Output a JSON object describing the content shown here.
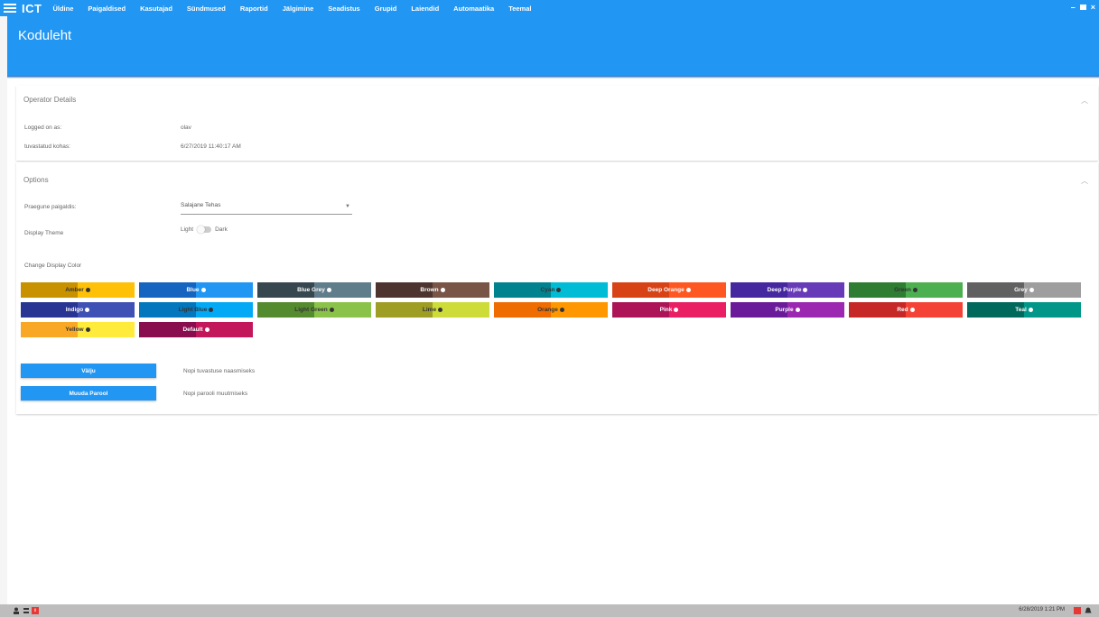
{
  "nav": {
    "brand": "ICT",
    "items": [
      "Üldine",
      "Paigaldised",
      "Kasutajad",
      "Sündmused",
      "Raportid",
      "Jälgimine",
      "Seadistus",
      "Grupid",
      "Laiendid",
      "Automaatika",
      "Teemal"
    ]
  },
  "header": {
    "title": "Koduleht"
  },
  "operator": {
    "title": "Operator Details",
    "logged_label": "Logged on as:",
    "logged_value": "olav",
    "auth_label": "tuvastatud kohas:",
    "auth_value": "6/27/2019 11:40:17 AM"
  },
  "options": {
    "title": "Options",
    "site_label": "Praegune paigaldis:",
    "site_value": "Salajane Tehas",
    "theme_label": "Display Theme",
    "theme_light": "Light",
    "theme_dark": "Dark",
    "color_label": "Change Display Color",
    "colors": [
      {
        "name": "Amber",
        "color": "#FFC107",
        "dark": "#C79100",
        "text": "#333333"
      },
      {
        "name": "Blue",
        "color": "#2196F3",
        "dark": "#1565C0",
        "text": "#ffffff"
      },
      {
        "name": "Blue Grey",
        "color": "#607D8B",
        "dark": "#37474F",
        "text": "#ffffff"
      },
      {
        "name": "Brown",
        "color": "#795548",
        "dark": "#4E342E",
        "text": "#ffffff"
      },
      {
        "name": "Cyan",
        "color": "#00BCD4",
        "dark": "#00838F",
        "text": "#333333"
      },
      {
        "name": "Deep Orange",
        "color": "#FF5722",
        "dark": "#D84315",
        "text": "#ffffff"
      },
      {
        "name": "Deep Purple",
        "color": "#673AB7",
        "dark": "#4527A0",
        "text": "#ffffff"
      },
      {
        "name": "Green",
        "color": "#4CAF50",
        "dark": "#2E7D32",
        "text": "#333333"
      },
      {
        "name": "Grey",
        "color": "#9E9E9E",
        "dark": "#616161",
        "text": "#ffffff"
      },
      {
        "name": "Indigo",
        "color": "#3F51B5",
        "dark": "#283593",
        "text": "#ffffff"
      },
      {
        "name": "Light Blue",
        "color": "#03A9F4",
        "dark": "#0277BD",
        "text": "#333333"
      },
      {
        "name": "Light Green",
        "color": "#8BC34A",
        "dark": "#558B2F",
        "text": "#333333"
      },
      {
        "name": "Lime",
        "color": "#CDDC39",
        "dark": "#9E9D24",
        "text": "#333333"
      },
      {
        "name": "Orange",
        "color": "#FF9800",
        "dark": "#EF6C00",
        "text": "#333333"
      },
      {
        "name": "Pink",
        "color": "#E91E63",
        "dark": "#AD1457",
        "text": "#ffffff"
      },
      {
        "name": "Purple",
        "color": "#9C27B0",
        "dark": "#6A1B9A",
        "text": "#ffffff"
      },
      {
        "name": "Red",
        "color": "#F44336",
        "dark": "#C62828",
        "text": "#ffffff"
      },
      {
        "name": "Teal",
        "color": "#009688",
        "dark": "#00695C",
        "text": "#ffffff"
      },
      {
        "name": "Yellow",
        "color": "#FFEB3B",
        "dark": "#F9A825",
        "text": "#333333"
      },
      {
        "name": "Default",
        "color": "#C2185B",
        "dark": "#880E4F",
        "text": "#ffffff"
      }
    ]
  },
  "actions": {
    "logout_label": "Välju",
    "logout_desc": "Nopi tuvastuse naasmiseks",
    "password_label": "Muuda Parool",
    "password_desc": "Nopi parooli muutmiseks"
  },
  "taskbar": {
    "time": "6/28/2019 1:21 PM"
  }
}
